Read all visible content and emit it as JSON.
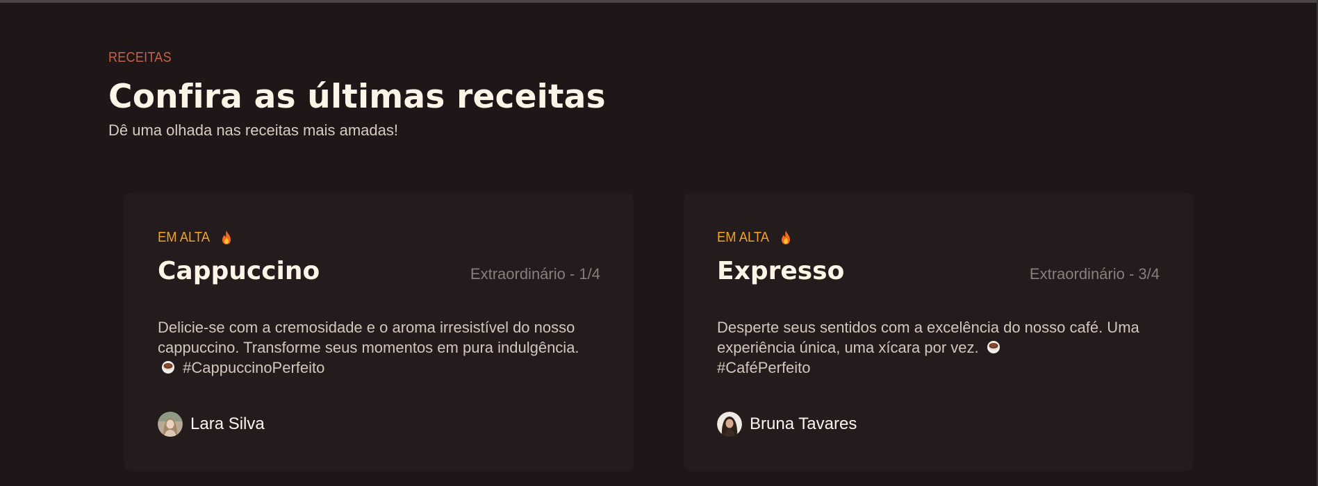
{
  "section": {
    "eyebrow": "RECEITAS",
    "title": "Confira as últimas receitas",
    "subtitle": "Dê uma olhada nas receitas mais amadas!"
  },
  "colors": {
    "background": "#1e1617",
    "card": "#241b1c",
    "eyebrow": "#c4604c",
    "badge": "#f0a22b",
    "title": "#fdf3e6",
    "muted": "#8a7e7a"
  },
  "cards": [
    {
      "badge": "EM ALTA",
      "badge_icon": "fire-icon",
      "title": "Cappuccino",
      "rating": "Extraordinário - 1/4",
      "description_before": "Delicie-se com a cremosidade e o aroma irresistível do nosso cappuccino. Transforme seus momentos em pura indulgência.",
      "description_icon": "coffee-cup-icon",
      "description_after": "#CappuccinoPerfeito",
      "author": "Lara Silva"
    },
    {
      "badge": "EM ALTA",
      "badge_icon": "fire-icon",
      "title": "Expresso",
      "rating": "Extraordinário - 3/4",
      "description_before": "Desperte seus sentidos com a excelência do nosso café. Uma experiência única, uma xícara por vez.",
      "description_icon": "coffee-cup-icon",
      "description_after": "#CaféPerfeito",
      "author": "Bruna Tavares"
    }
  ]
}
